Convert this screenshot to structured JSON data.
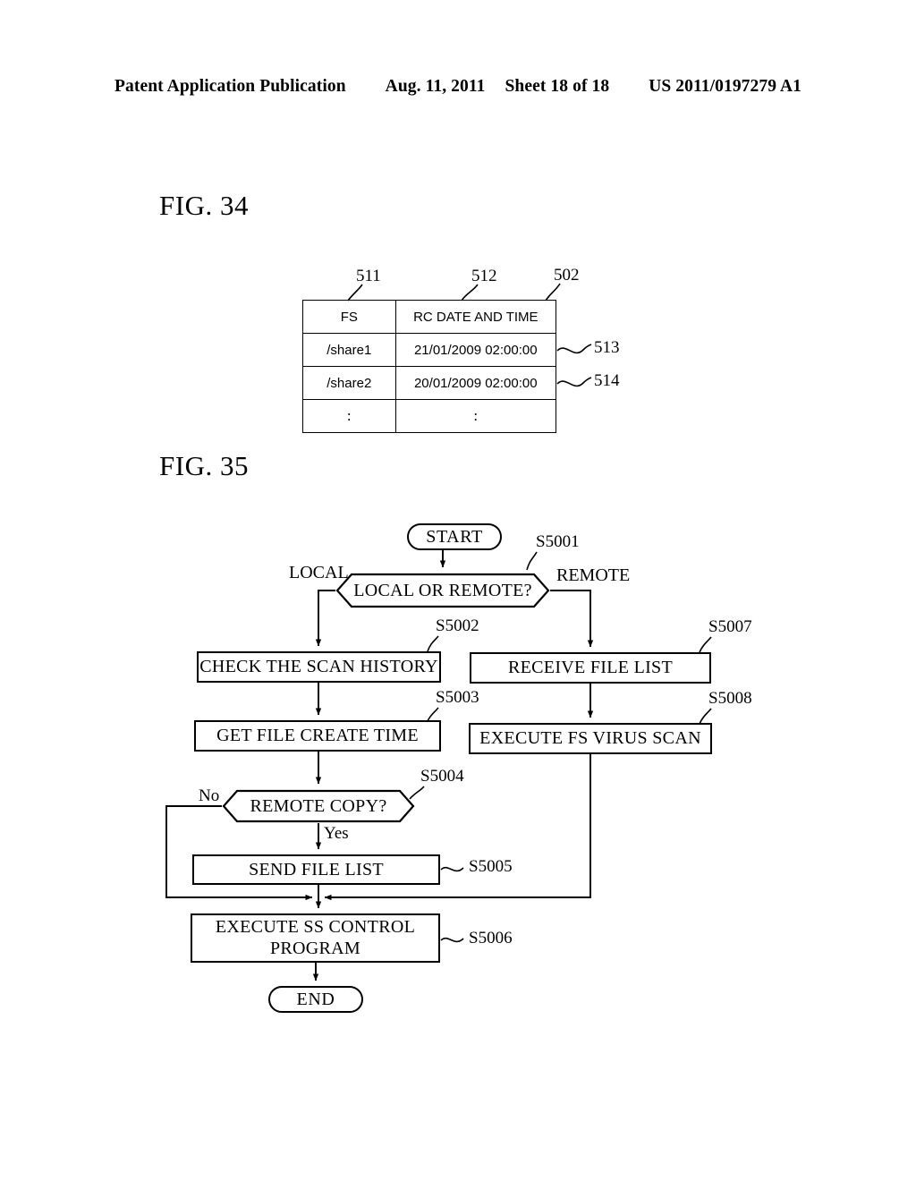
{
  "header": {
    "publication": "Patent Application Publication",
    "date": "Aug. 11, 2011",
    "sheet": "Sheet 18 of 18",
    "docnum": "US 2011/0197279 A1"
  },
  "fig34": {
    "caption": "FIG. 34",
    "table": {
      "headers": [
        "FS",
        "RC  DATE AND TIME"
      ],
      "rows": [
        [
          "/share1",
          "21/01/2009 02:00:00"
        ],
        [
          "/share2",
          "20/01/2009 02:00:00"
        ],
        [
          ":",
          ":"
        ]
      ]
    },
    "refs": {
      "col_fs": "511",
      "col_rc": "512",
      "table": "502",
      "row1": "513",
      "row2": "514"
    }
  },
  "fig35": {
    "caption": "FIG. 35",
    "nodes": {
      "start": "START",
      "decision_local_remote": "LOCAL OR REMOTE?",
      "check_scan_history": "CHECK THE SCAN HISTORY",
      "get_file_create_time": "GET FILE CREATE TIME",
      "decision_remote_copy": "REMOTE COPY?",
      "send_file_list": "SEND FILE LIST",
      "receive_file_list": "RECEIVE FILE LIST",
      "execute_fs_virus_scan": "EXECUTE FS VIRUS SCAN",
      "execute_ss_control_program": "EXECUTE SS CONTROL PROGRAM",
      "end": "END"
    },
    "branch_labels": {
      "local": "LOCAL",
      "remote": "REMOTE",
      "no": "No",
      "yes": "Yes"
    },
    "steps": {
      "s5001": "S5001",
      "s5002": "S5002",
      "s5003": "S5003",
      "s5004": "S5004",
      "s5005": "S5005",
      "s5006": "S5006",
      "s5007": "S5007",
      "s5008": "S5008"
    }
  },
  "colors": {
    "ink": "#000000",
    "paper": "#ffffff"
  }
}
